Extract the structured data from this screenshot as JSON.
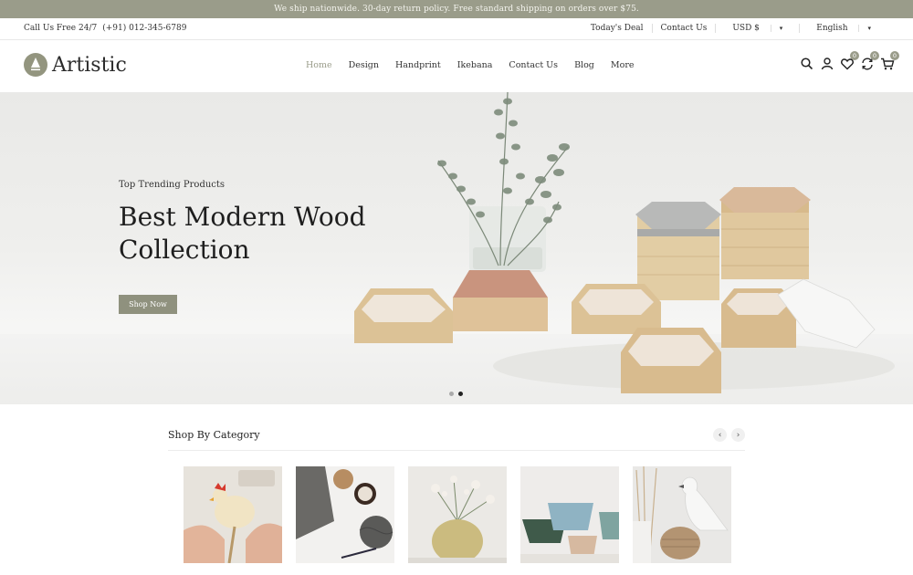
{
  "announcement": "We ship nationwide. 30-day return policy. Free standard shipping on orders over $75.",
  "topbar": {
    "call_label": "Call Us Free 24/7",
    "phone": "(+91) 012-345-6789",
    "links": [
      "Today's Deal",
      "Contact Us",
      "USD $",
      "English"
    ]
  },
  "header": {
    "logo_text": "Artistic",
    "nav": [
      "Home",
      "Design",
      "Handprint",
      "Ikebana",
      "Contact Us",
      "Blog",
      "More"
    ],
    "badges": {
      "wishlist": "0",
      "compare": "0",
      "cart": "0"
    }
  },
  "hero": {
    "subtitle": "Top Trending Products",
    "title_line1": "Best Modern Wood",
    "title_line2": "Collection",
    "cta": "Shop Now",
    "slides": 2,
    "active_slide": 2
  },
  "categories": {
    "title": "Shop By Category",
    "prev_icon": "chevron-left-icon",
    "next_icon": "chevron-right-icon"
  },
  "colors": {
    "accent": "#9a9c8a",
    "button": "#8f917e"
  }
}
